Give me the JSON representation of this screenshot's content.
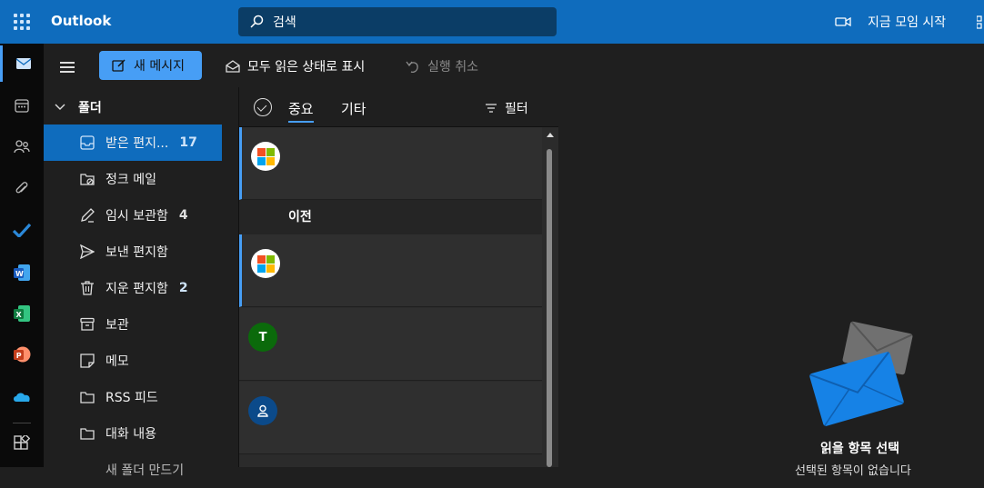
{
  "header": {
    "app_name": "Outlook",
    "search_placeholder": "검색",
    "meet_now": "지금 모임 시작",
    "accent": "#0f6cbd"
  },
  "rail": {
    "items": [
      "mail-icon",
      "calendar-icon",
      "people-icon",
      "attach-icon",
      "todo-icon",
      "word-icon",
      "excel-icon",
      "powerpoint-icon",
      "onedrive-icon",
      "more-apps-icon"
    ]
  },
  "toolbar": {
    "new_message": "새 메시지",
    "mark_all_read": "모두 읽은 상태로 표시",
    "undo": "실행 취소"
  },
  "folders": {
    "header": "폴더",
    "items": [
      {
        "label": "받은 편지...",
        "count": "17"
      },
      {
        "label": "정크 메일",
        "count": ""
      },
      {
        "label": "임시 보관함",
        "count": "4"
      },
      {
        "label": "보낸 편지함",
        "count": ""
      },
      {
        "label": "지운 편지함",
        "count": "2"
      },
      {
        "label": "보관",
        "count": ""
      },
      {
        "label": "메모",
        "count": ""
      },
      {
        "label": "RSS 피드",
        "count": ""
      },
      {
        "label": "대화 내용",
        "count": ""
      },
      {
        "label": "새 폴더 만드기",
        "count": ""
      }
    ]
  },
  "list": {
    "tabs": [
      "중요",
      "기타"
    ],
    "filter": "필터",
    "section_label": "이전",
    "avatars": [
      "ms",
      "ms",
      "T",
      "person"
    ]
  },
  "reading": {
    "title": "읽을 항목 선택",
    "subtitle": "선택된 항목이 없습니다"
  }
}
